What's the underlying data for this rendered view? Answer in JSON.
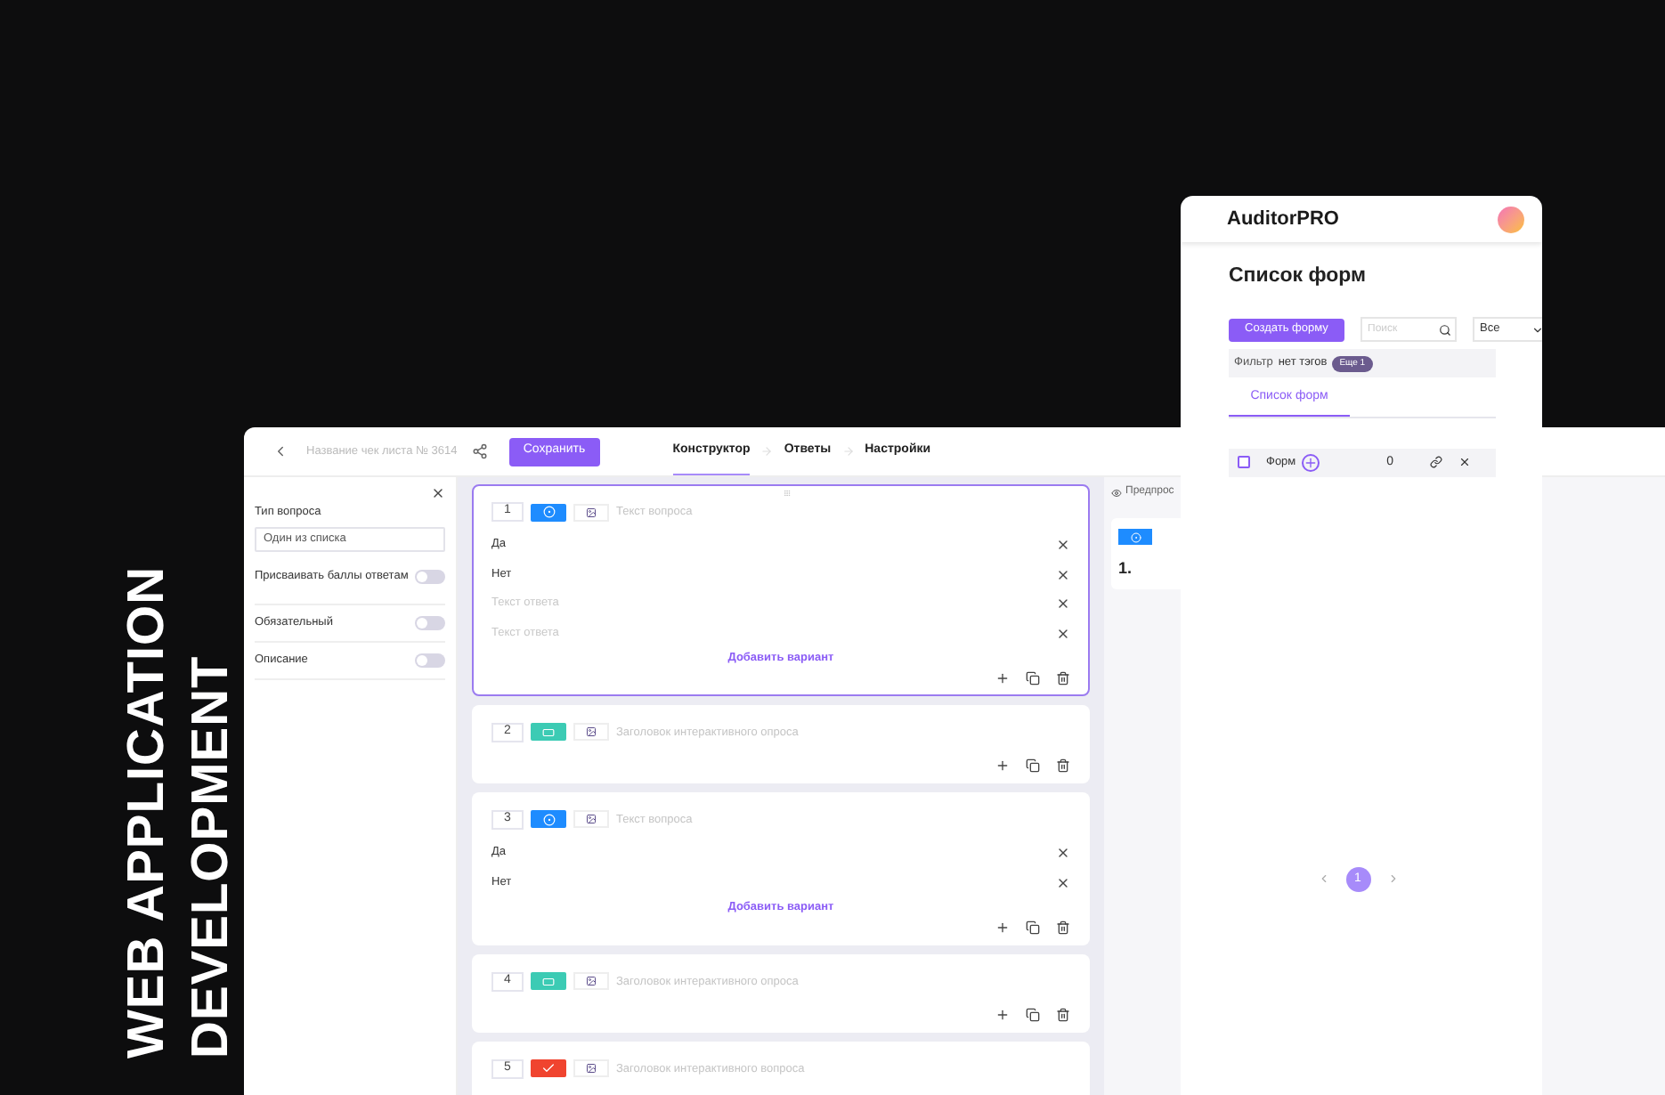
{
  "headline": [
    "WEB APPLICATION",
    "DEVELOPMENT"
  ],
  "editor": {
    "title": "Название чек листа № 3614",
    "save_button": "Сохранить",
    "tabs": [
      {
        "label": "Конструктор",
        "selected": true
      },
      {
        "label": "Ответы",
        "selected": false
      },
      {
        "label": "Настройки",
        "selected": false
      }
    ],
    "settings": {
      "type_label": "Тип вопроса",
      "type_value": "Один из списка",
      "toggles": [
        {
          "label": "Присваивать баллы ответам",
          "on": false
        },
        {
          "label": "Обязательный",
          "on": false
        },
        {
          "label": "Описание",
          "on": false
        }
      ]
    },
    "questions": [
      {
        "number": "1",
        "kind": "choice",
        "selected": true,
        "placeholder": "Текст вопроса",
        "options": [
          {
            "text": "Да"
          },
          {
            "text": "Нет"
          },
          {
            "placeholder": "Текст ответа"
          },
          {
            "placeholder": "Текст ответа"
          }
        ],
        "add_label": "Добавить вариант"
      },
      {
        "number": "2",
        "kind": "interactive",
        "selected": false,
        "placeholder": "Заголовок интерактивного опроса"
      },
      {
        "number": "3",
        "kind": "choice",
        "selected": false,
        "placeholder": "Текст вопроса",
        "options": [
          {
            "text": "Да"
          },
          {
            "text": "Нет"
          }
        ],
        "add_label": "Добавить вариант"
      },
      {
        "number": "4",
        "kind": "interactive",
        "selected": false,
        "placeholder": "Заголовок интерактивного опроса"
      },
      {
        "number": "5",
        "kind": "check",
        "selected": false,
        "placeholder": "Заголовок интерактивного вопроса"
      }
    ],
    "preview": {
      "label": "Предпрос",
      "number": "1."
    }
  },
  "forms_app": {
    "brand": "AuditorPRO",
    "title": "Список форм",
    "create_button": "Создать форму",
    "search_placeholder": "Поиск",
    "select_value": "Все",
    "filter_label": "Фильтр",
    "filter_value": "нет тэгов",
    "more_badge": "Еще 1",
    "tab": "Список форм",
    "rows": [
      {
        "name": "Форм",
        "count": "0",
        "checked": false
      }
    ],
    "pages": [
      {
        "label": "1",
        "selected": true
      }
    ]
  }
}
